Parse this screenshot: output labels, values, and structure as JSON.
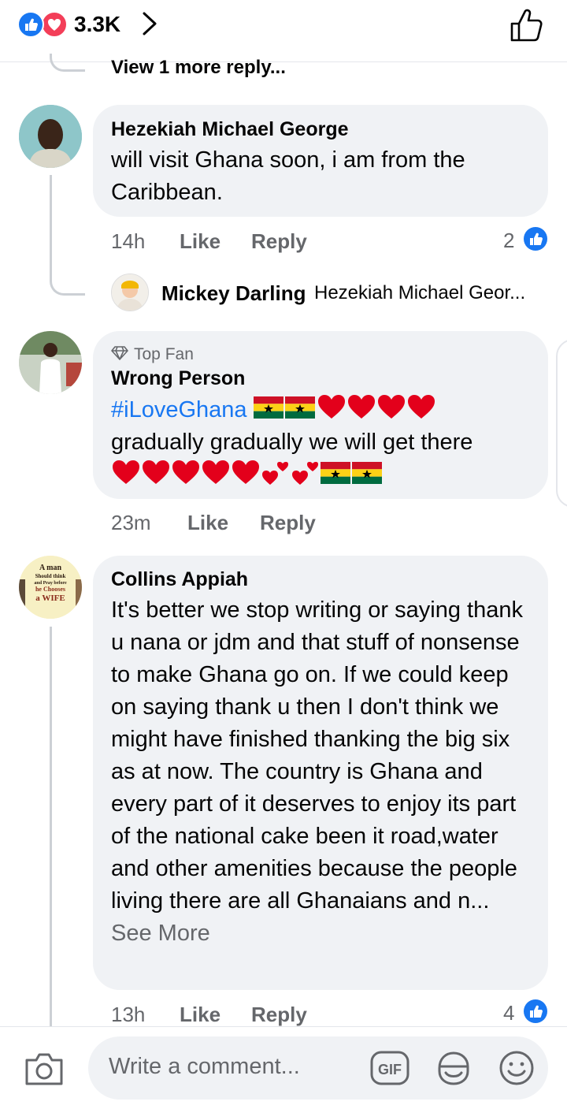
{
  "header": {
    "reaction_count": "3.3K"
  },
  "view_more": "View 1 more reply...",
  "comments": [
    {
      "name": "Hezekiah Michael George",
      "text": "will visit Ghana soon, i am from the Caribbean.",
      "time": "14h",
      "like": "Like",
      "reply": "Reply",
      "reactions": "2"
    },
    {
      "name": "Wrong Person",
      "badge": "Top Fan",
      "hashtag": "#iLoveGhana",
      "text": "gradually gradually we will get there",
      "time": "23m",
      "like": "Like",
      "reply": "Reply"
    },
    {
      "name": "Collins Appiah",
      "text": "It's better we stop writing or saying thank u nana or jdm and that stuff of nonsense to make Ghana go on. If we could keep on saying thank u then  I don't think we might have finished thanking the big six as at now. The country is Ghana and every part of it deserves to enjoy its part of the national cake been it road,water and other amenities because the people living there are all Ghanaians and n...",
      "see_more": "See More",
      "avatar_text": [
        "A man",
        "Should think",
        "and Pray before",
        "he Chooses",
        "a WIFE"
      ],
      "time": "13h",
      "like": "Like",
      "reply": "Reply",
      "reactions": "4"
    }
  ],
  "nested_reply": {
    "name": "Mickey Darling",
    "preview": "Hezekiah Michael Geor..."
  },
  "composer": {
    "placeholder": "Write a comment..."
  },
  "colors": {
    "accent": "#1877f2",
    "love": "#f33e58",
    "bubble": "#f0f2f5",
    "muted": "#65676b"
  }
}
